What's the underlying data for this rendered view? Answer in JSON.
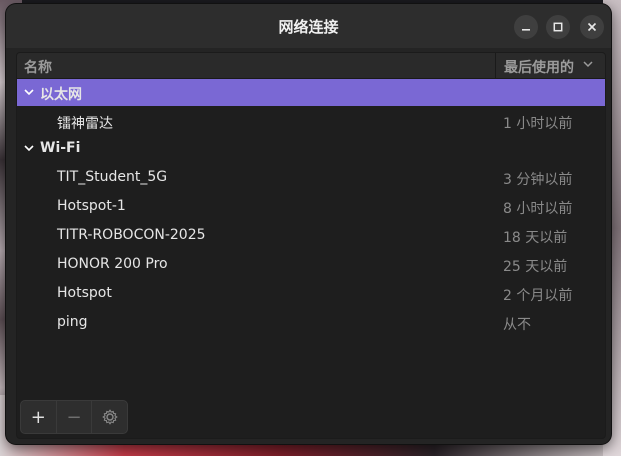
{
  "window": {
    "title": "网络连接"
  },
  "columns": {
    "name": "名称",
    "last_used": "最后使用的"
  },
  "groups": [
    {
      "label": "以太网",
      "selected": true,
      "items": [
        {
          "name": "镭神雷达",
          "last_used": "1 小时以前"
        }
      ]
    },
    {
      "label": "Wi-Fi",
      "selected": false,
      "items": [
        {
          "name": "TIT_Student_5G",
          "last_used": "3 分钟以前"
        },
        {
          "name": "Hotspot-1",
          "last_used": "8 小时以前"
        },
        {
          "name": "TITR-ROBOCON-2025",
          "last_used": "18 天以前"
        },
        {
          "name": "HONOR 200 Pro",
          "last_used": "25 天以前"
        },
        {
          "name": "Hotspot",
          "last_used": "2 个月以前"
        },
        {
          "name": "ping",
          "last_used": "从不"
        }
      ]
    }
  ],
  "toolbar": {
    "add": "+",
    "remove": "−"
  },
  "icons": {
    "minimize": "minimize-icon",
    "maximize": "maximize-icon",
    "close": "close-icon",
    "sort": "chevron-down-icon",
    "settings": "gear-icon"
  },
  "colors": {
    "selection": "#7a68d4"
  }
}
